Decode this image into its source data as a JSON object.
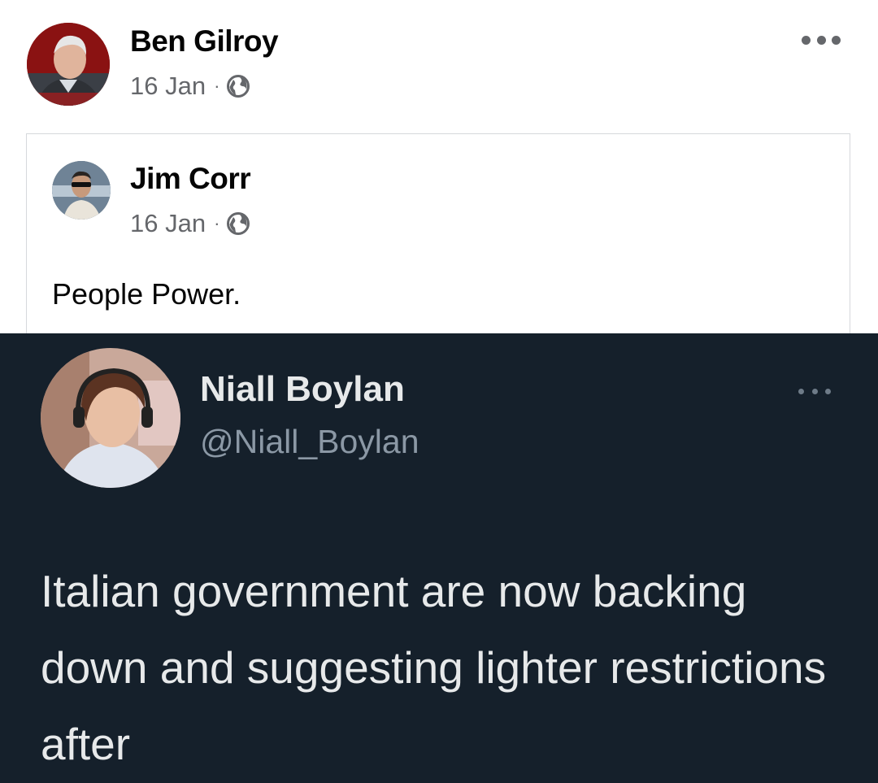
{
  "post": {
    "author": "Ben Gilroy",
    "date": "16 Jan",
    "separator": "·",
    "avatar_icon": "person-avatar",
    "privacy_icon": "globe-icon",
    "more_icon": "ellipsis-icon"
  },
  "shared": {
    "author": "Jim Corr",
    "date": "16 Jan",
    "separator": "·",
    "avatar_icon": "person-avatar",
    "privacy_icon": "globe-icon",
    "text": "People Power."
  },
  "tweet": {
    "name": "Niall Boylan",
    "handle": "@Niall_Boylan",
    "text": "Italian government are now backing down and suggesting lighter restrictions after",
    "more_icon": "ellipsis-icon"
  },
  "colors": {
    "fb_text": "#050505",
    "fb_meta": "#65676b",
    "tweet_bg": "#15202b",
    "tweet_text": "#e7e9ea",
    "tweet_handle": "#8b98a5"
  }
}
